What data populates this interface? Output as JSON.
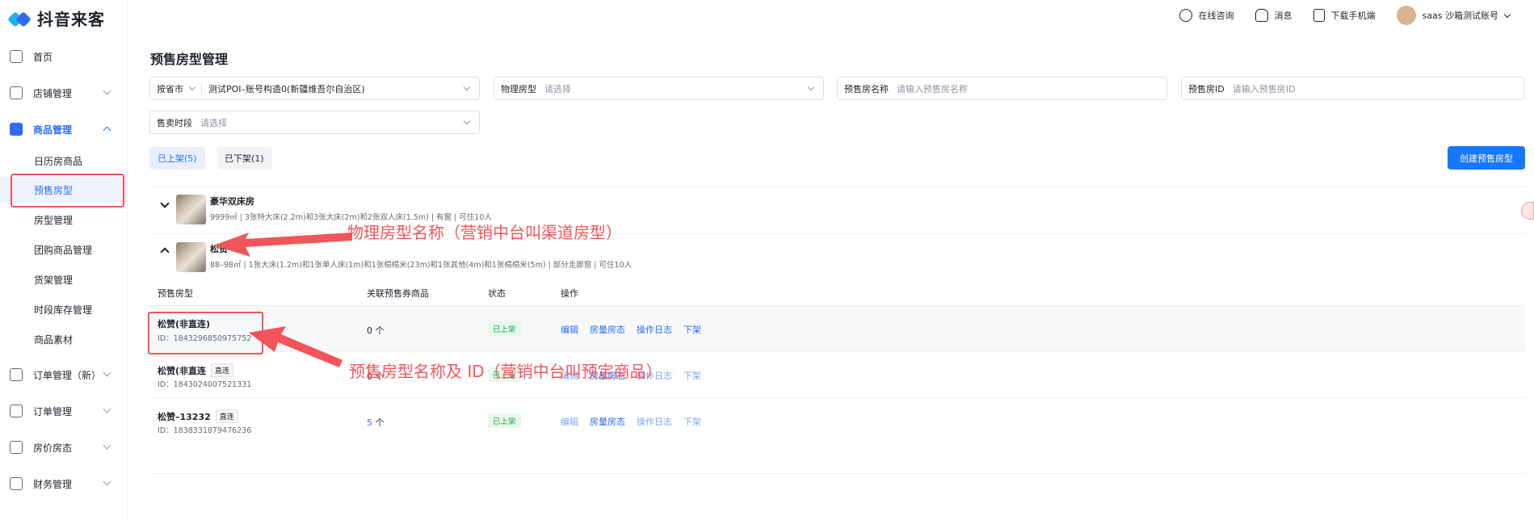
{
  "app": {
    "logo_text": "抖音来客"
  },
  "sidebar": {
    "items": [
      {
        "label": "首页",
        "icon": "home-icon"
      },
      {
        "label": "店铺管理",
        "icon": "store-icon"
      },
      {
        "label": "商品管理",
        "icon": "bag-icon"
      },
      {
        "label": "订单管理（新）",
        "icon": "order-icon"
      },
      {
        "label": "订单管理",
        "icon": "order-icon"
      },
      {
        "label": "房价房态",
        "icon": "bed-icon"
      },
      {
        "label": "财务管理",
        "icon": "wallet-icon"
      }
    ],
    "sub_items": [
      {
        "label": "日历房商品"
      },
      {
        "label": "预售房型"
      },
      {
        "label": "房型管理"
      },
      {
        "label": "团购商品管理"
      },
      {
        "label": "货架管理"
      },
      {
        "label": "时段库存管理"
      },
      {
        "label": "商品素材"
      }
    ]
  },
  "topbar": {
    "consult": "在线咨询",
    "messages": "消息",
    "download": "下载手机端",
    "account": "saas 沙箱测试账号"
  },
  "page": {
    "title": "预售房型管理"
  },
  "filters": {
    "region_label": "按省市",
    "region_value": "测试POI–账号构造0(新疆维吾尔自治区)",
    "physical_label": "物理房型",
    "physical_placeholder": "请选择",
    "presale_name_label": "预售房名称",
    "presale_name_placeholder": "请输入预售房名称",
    "presale_id_label": "预售房ID",
    "presale_id_placeholder": "请输入预售房ID",
    "period_label": "售卖时段",
    "period_placeholder": "请选择"
  },
  "tabs": [
    {
      "label": "已上架(5)"
    },
    {
      "label": "已下架(1)"
    }
  ],
  "create_button": "创建预售房型",
  "rooms": [
    {
      "name": "豪华双床房",
      "desc": "9999㎡ | 3张特大床(2.2m)和3张大床(2m)和2张双人床(1.5m) | 有窗 | 可住10人"
    },
    {
      "name": "松赞",
      "desc": "88–98㎡ | 1张大床(1.2m)和1张单人床(1m)和1张榻榻米(23m)和1张其他(4m)和1张榻榻米(5m) | 部分走廊窗 | 可住10人"
    }
  ],
  "annotations": {
    "physical": "物理房型名称（营销中台叫渠道房型）",
    "presale": "预售房型名称及 ID（营销中台叫预定商品）"
  },
  "table": {
    "headers": [
      "预售房型",
      "关联预售券商品",
      "状态",
      "操作"
    ],
    "rows": [
      {
        "name": "松赞(非直连)",
        "tag": "",
        "id": "ID：1843296850975752",
        "count_num": "",
        "count": "0 个",
        "status": "已上架",
        "ops": [
          "编辑",
          "房量房态",
          "操作日志",
          "下架"
        ]
      },
      {
        "name": "松赞(非直连",
        "tag": "直连",
        "id": "ID：1843024007521331",
        "count_num": "",
        "count": "0 个",
        "status": "已上架",
        "ops": [
          "编辑",
          "房量房态",
          "操作日志",
          "下架"
        ]
      },
      {
        "name": "松赞–13232",
        "tag": "直连",
        "id": "ID：1838331879476236",
        "count_num": "5",
        "count": " 个",
        "status": "已上架",
        "ops": [
          "编辑",
          "房量房态",
          "操作日志",
          "下架"
        ]
      }
    ]
  }
}
